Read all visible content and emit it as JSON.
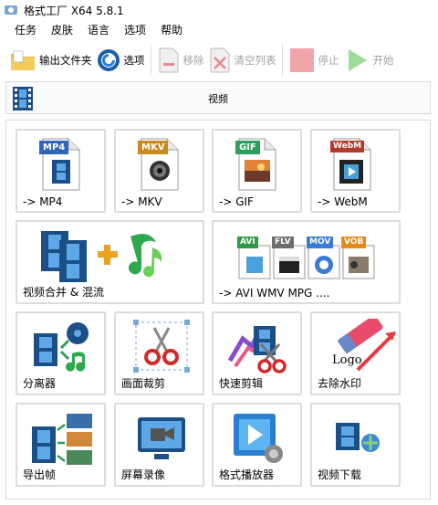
{
  "window": {
    "title": "格式工厂 X64 5.8.1"
  },
  "menu": [
    "任务",
    "皮肤",
    "语言",
    "选项",
    "帮助"
  ],
  "toolbar": {
    "output_folder": "输出文件夹",
    "options": "选项",
    "remove": "移除",
    "clear_list": "清空列表",
    "stop": "停止",
    "start": "开始"
  },
  "section": {
    "title": "视频"
  },
  "tiles": {
    "mp4": {
      "label": "-> MP4",
      "tag": "MP4"
    },
    "mkv": {
      "label": "-> MKV",
      "tag": "MKV"
    },
    "gif": {
      "label": "-> GIF",
      "tag": "GIF"
    },
    "webm": {
      "label": "-> WebM",
      "tag": "WebM"
    },
    "merge": {
      "label": "视频合并 & 混流"
    },
    "multi": {
      "label": "-> AVI WMV MPG ....",
      "tags": [
        "AVI",
        "FLV",
        "MOV",
        "VOB"
      ]
    },
    "splitter": {
      "label": "分离器"
    },
    "crop": {
      "label": "画面裁剪"
    },
    "quick_cut": {
      "label": "快速剪辑"
    },
    "watermark": {
      "label": "去除水印",
      "logo_text": "Logo"
    },
    "export_frames": {
      "label": "导出帧"
    },
    "screen_record": {
      "label": "屏幕录像"
    },
    "player": {
      "label": "格式播放器"
    },
    "download": {
      "label": "视频下载"
    }
  },
  "colors": {
    "mp4_tag": "#2e66b8",
    "mkv_tag": "#c98a1f",
    "gif_tag": "#2e9e5c",
    "webm_tag": "#b3392c",
    "avi_tag": "#2f9a4a",
    "flv_tag": "#6d6d6d",
    "mov_tag": "#3a7bd5",
    "vob_tag": "#e08a1a"
  }
}
